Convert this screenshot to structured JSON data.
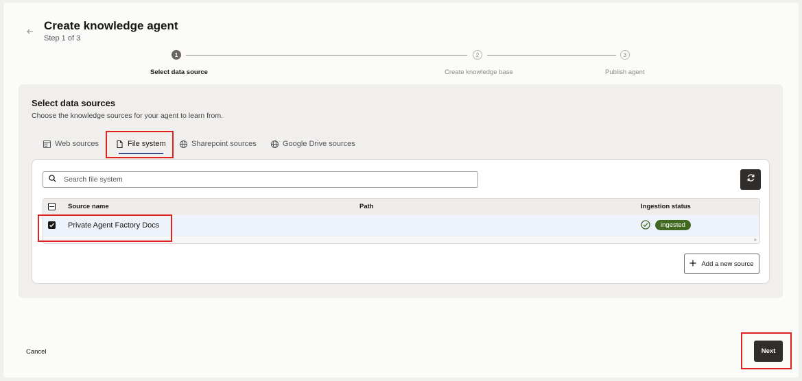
{
  "header": {
    "title": "Create knowledge agent",
    "subtitle": "Step 1 of 3"
  },
  "stepper": {
    "steps": [
      {
        "number": "1",
        "label": "Select data source",
        "state": "active"
      },
      {
        "number": "2",
        "label": "Create knowledge base",
        "state": "inactive"
      },
      {
        "number": "3",
        "label": "Publish agent",
        "state": "inactive"
      }
    ]
  },
  "panel": {
    "title": "Select data sources",
    "description": "Choose the knowledge sources for your agent to learn from."
  },
  "tabs": [
    {
      "label": "Web sources",
      "icon": "web-page-icon",
      "active": false
    },
    {
      "label": "File system",
      "icon": "file-icon",
      "active": true
    },
    {
      "label": "Sharepoint sources",
      "icon": "globe-icon",
      "active": false
    },
    {
      "label": "Google Drive sources",
      "icon": "globe-icon",
      "active": false
    }
  ],
  "search": {
    "placeholder": "Search file system",
    "value": ""
  },
  "table": {
    "columns": [
      "Source name",
      "Path",
      "Ingestion status"
    ],
    "rows": [
      {
        "selected": true,
        "source_name": "Private Agent Factory Docs",
        "path": "",
        "status": "ingested"
      }
    ]
  },
  "actions": {
    "add_source": "Add a new source",
    "cancel": "Cancel",
    "next": "Next"
  },
  "colors": {
    "accent": "#312d2a",
    "status_ingested": "#406820",
    "highlight": "#e1211d",
    "tab_underline": "#3a4b8a"
  }
}
